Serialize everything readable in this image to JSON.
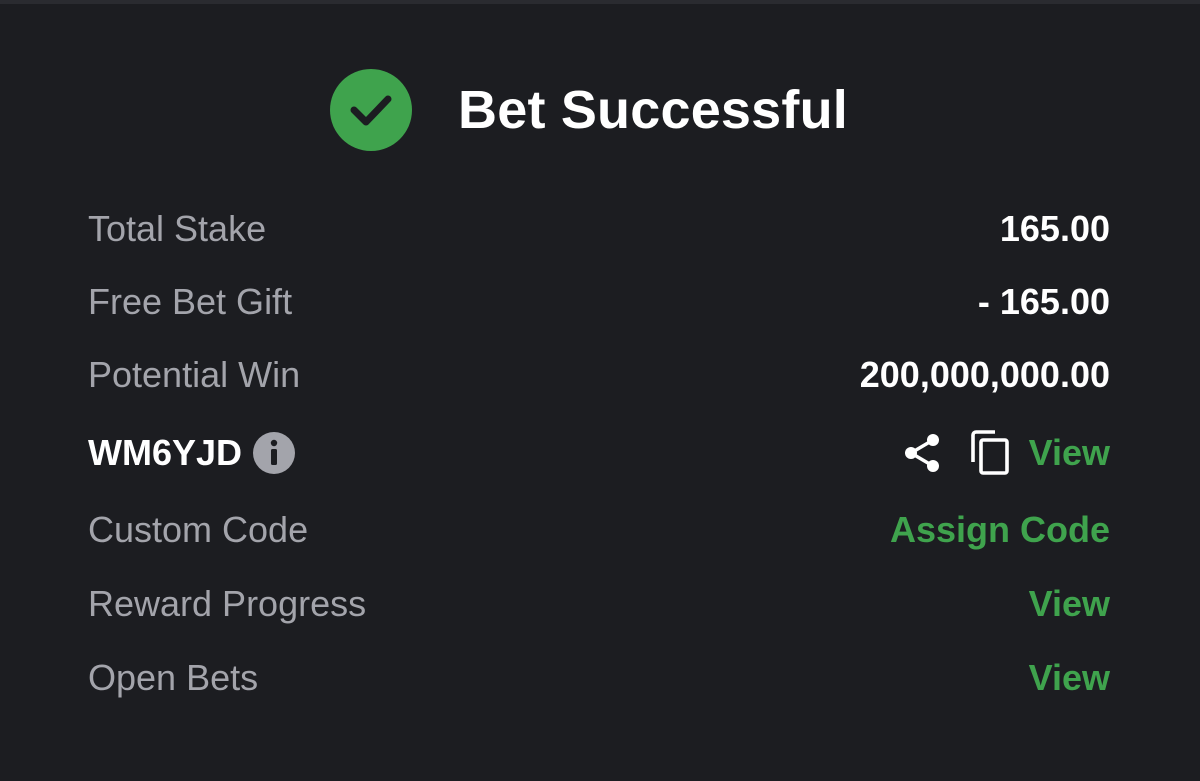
{
  "header": {
    "title": "Bet Successful",
    "icon": "check-circle-icon",
    "icon_color": "#3fa34d"
  },
  "summary": {
    "total_stake_label": "Total Stake",
    "total_stake_value": "165.00",
    "free_bet_label": "Free Bet Gift",
    "free_bet_value": "- 165.00",
    "potential_win_label": "Potential Win",
    "potential_win_value": "200,000,000.00"
  },
  "booking": {
    "code": "WM6YJD",
    "info_icon": "info-icon",
    "share_icon": "share-icon",
    "copy_icon": "copy-icon",
    "view_label": "View"
  },
  "custom_code": {
    "label": "Custom Code",
    "action_label": "Assign Code"
  },
  "reward_progress": {
    "label": "Reward Progress",
    "action_label": "View"
  },
  "open_bets": {
    "label": "Open Bets",
    "action_label": "View"
  },
  "colors": {
    "background": "#1c1d21",
    "accent_green": "#3fa34d",
    "label_gray": "#a3a4ab",
    "value_white": "#ffffff"
  }
}
